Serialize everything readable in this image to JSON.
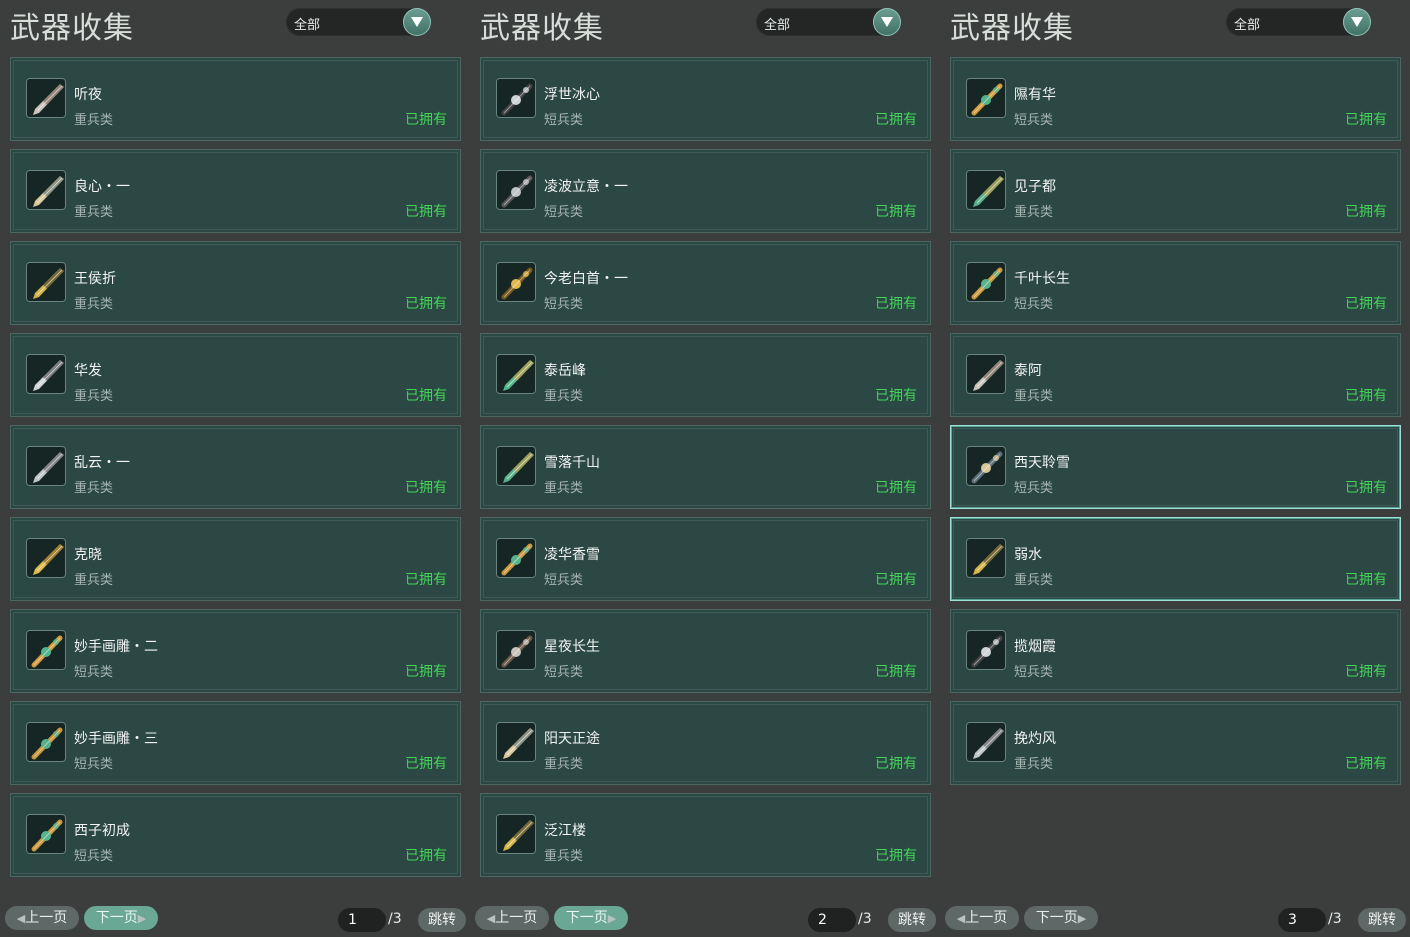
{
  "panels": [
    {
      "title": "武器收集",
      "filter_value": "全部",
      "items": [
        {
          "name": "听夜",
          "type": "重兵类",
          "status": "已拥有",
          "icon": "heavy-blade-icon"
        },
        {
          "name": "良心・一",
          "type": "重兵类",
          "status": "已拥有",
          "icon": "heavy-blade-icon"
        },
        {
          "name": "王侯折",
          "type": "重兵类",
          "status": "已拥有",
          "icon": "heavy-blade-icon"
        },
        {
          "name": "华发",
          "type": "重兵类",
          "status": "已拥有",
          "icon": "heavy-blade-icon"
        },
        {
          "name": "乱云・一",
          "type": "重兵类",
          "status": "已拥有",
          "icon": "heavy-blade-icon"
        },
        {
          "name": "克晓",
          "type": "重兵类",
          "status": "已拥有",
          "icon": "heavy-blade-icon"
        },
        {
          "name": "妙手画雕・二",
          "type": "短兵类",
          "status": "已拥有",
          "icon": "short-weapon-icon"
        },
        {
          "name": "妙手画雕・三",
          "type": "短兵类",
          "status": "已拥有",
          "icon": "short-weapon-icon"
        },
        {
          "name": "西子初成",
          "type": "短兵类",
          "status": "已拥有",
          "icon": "short-weapon-icon"
        }
      ],
      "selected": [],
      "pager": {
        "prev": "上一页",
        "next": "下一页",
        "page": "1",
        "total": "/3",
        "jump": "跳转",
        "next_active": true
      }
    },
    {
      "title": "武器收集",
      "filter_value": "全部",
      "items": [
        {
          "name": "浮世冰心",
          "type": "短兵类",
          "status": "已拥有",
          "icon": "short-weapon-icon"
        },
        {
          "name": "凌波立意・一",
          "type": "短兵类",
          "status": "已拥有",
          "icon": "short-weapon-icon"
        },
        {
          "name": "今老白首・一",
          "type": "短兵类",
          "status": "已拥有",
          "icon": "short-weapon-icon"
        },
        {
          "name": "泰岳峰",
          "type": "重兵类",
          "status": "已拥有",
          "icon": "heavy-blade-icon"
        },
        {
          "name": "雪落千山",
          "type": "重兵类",
          "status": "已拥有",
          "icon": "heavy-blade-icon"
        },
        {
          "name": "凌华香雪",
          "type": "短兵类",
          "status": "已拥有",
          "icon": "short-weapon-icon"
        },
        {
          "name": "星夜长生",
          "type": "短兵类",
          "status": "已拥有",
          "icon": "short-weapon-icon"
        },
        {
          "name": "阳天正途",
          "type": "重兵类",
          "status": "已拥有",
          "icon": "heavy-blade-icon"
        },
        {
          "name": "泛江楼",
          "type": "重兵类",
          "status": "已拥有",
          "icon": "heavy-blade-icon"
        }
      ],
      "selected": [],
      "pager": {
        "prev": "上一页",
        "next": "下一页",
        "page": "2",
        "total": "/3",
        "jump": "跳转",
        "next_active": true
      }
    },
    {
      "title": "武器收集",
      "filter_value": "全部",
      "items": [
        {
          "name": "隰有华",
          "type": "短兵类",
          "status": "已拥有",
          "icon": "short-weapon-icon"
        },
        {
          "name": "见子都",
          "type": "重兵类",
          "status": "已拥有",
          "icon": "heavy-blade-icon"
        },
        {
          "name": "千叶长生",
          "type": "短兵类",
          "status": "已拥有",
          "icon": "short-weapon-icon"
        },
        {
          "name": "泰阿",
          "type": "重兵类",
          "status": "已拥有",
          "icon": "heavy-blade-icon"
        },
        {
          "name": "西天聆雪",
          "type": "短兵类",
          "status": "已拥有",
          "icon": "short-weapon-icon"
        },
        {
          "name": "弱水",
          "type": "重兵类",
          "status": "已拥有",
          "icon": "heavy-blade-icon"
        },
        {
          "name": "揽烟霞",
          "type": "短兵类",
          "status": "已拥有",
          "icon": "short-weapon-icon"
        },
        {
          "name": "挽灼风",
          "type": "重兵类",
          "status": "已拥有",
          "icon": "heavy-blade-icon"
        }
      ],
      "selected": [
        4,
        5
      ],
      "pager": {
        "prev": "上一页",
        "next": "下一页",
        "page": "3",
        "total": "/3",
        "jump": "跳转",
        "next_active": false
      }
    }
  ],
  "colors": {
    "owned": "#43d457",
    "card_bg": "#2c4845",
    "page_bg": "#3b3e3d",
    "accent": "#6aa895"
  }
}
